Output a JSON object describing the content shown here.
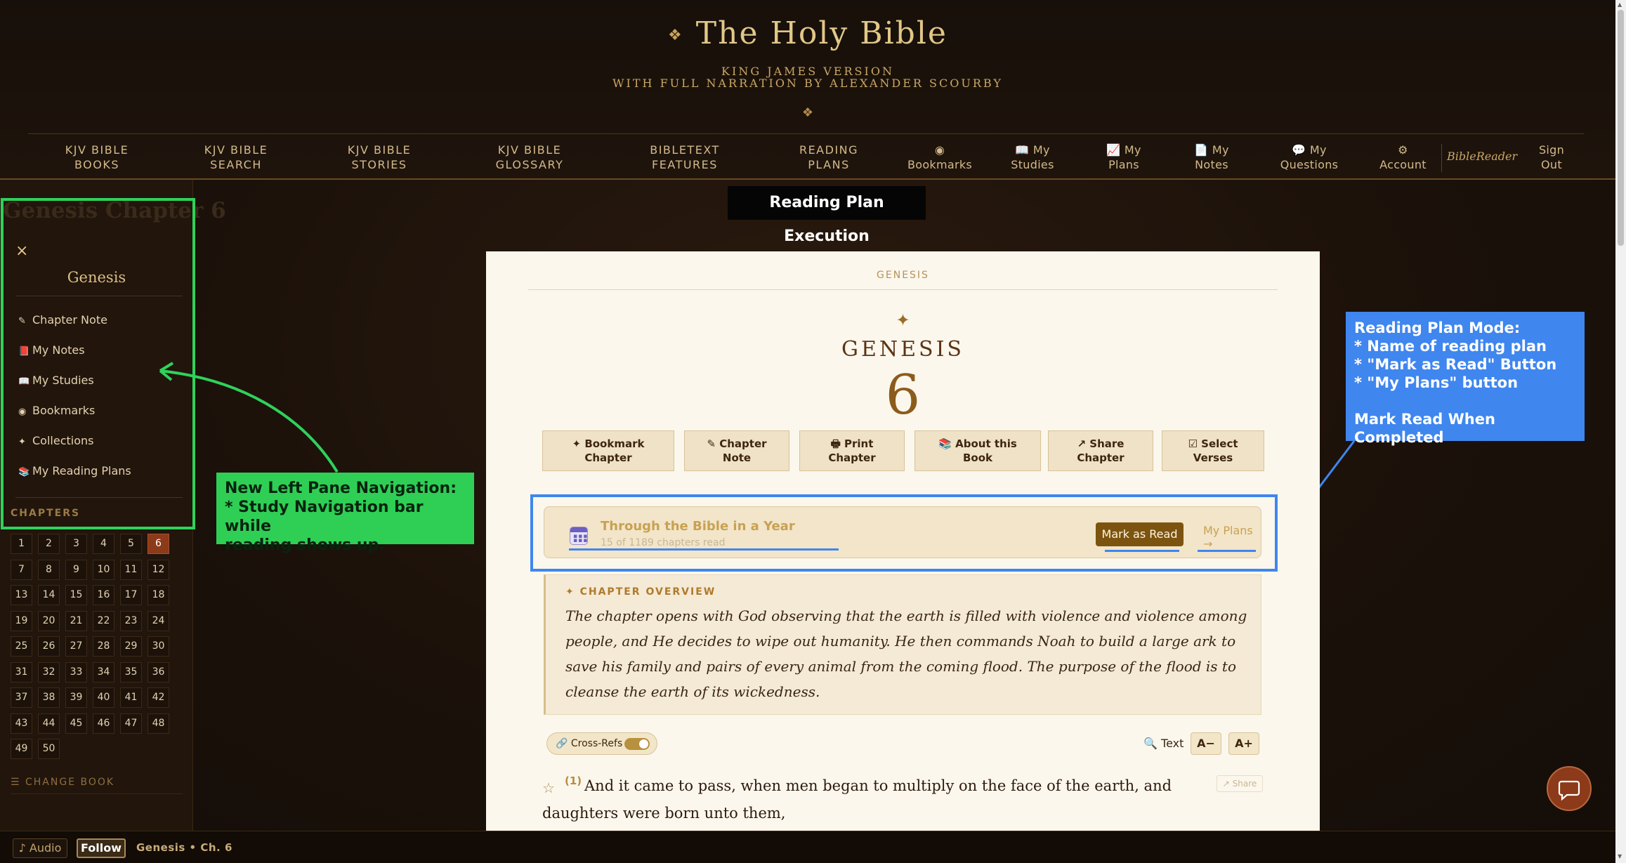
{
  "header": {
    "title": "The Holy Bible",
    "title_ornament": "❖",
    "subtitle_line1": "KING JAMES VERSION",
    "subtitle_line2": "WITH FULL NARRATION BY ALEXANDER SCOURBY",
    "ornament": "❖"
  },
  "nav": {
    "items": [
      {
        "line1": "KJV BIBLE",
        "line2": "BOOKS"
      },
      {
        "line1": "KJV BIBLE",
        "line2": "SEARCH"
      },
      {
        "line1": "KJV BIBLE",
        "line2": "STORIES"
      },
      {
        "line1": "KJV BIBLE",
        "line2": "GLOSSARY"
      },
      {
        "line1": "BIBLETEXT",
        "line2": "FEATURES"
      },
      {
        "line1": "READING",
        "line2": "PLANS"
      },
      {
        "line1": "◉",
        "line2": "Bookmarks"
      },
      {
        "line1": "📖 My",
        "line2": "Studies"
      },
      {
        "line1": "📈 My",
        "line2": "Plans"
      },
      {
        "line1": "📄 My",
        "line2": "Notes"
      },
      {
        "line1": "💬 My",
        "line2": "Questions"
      },
      {
        "line1": "⚙",
        "line2": "Account"
      },
      {
        "line1": "Sign",
        "line2": "Out"
      }
    ],
    "biblereader": "BibleReader"
  },
  "annotation_top": "Reading Plan Execution",
  "left_pane": {
    "ghost_title": "Genesis Chapter 6",
    "close": "×",
    "book": "Genesis",
    "links": [
      {
        "icon": "✎",
        "label": "Chapter Note"
      },
      {
        "icon": "📕",
        "label": "My Notes"
      },
      {
        "icon": "📖",
        "label": "My Studies"
      },
      {
        "icon": "◉",
        "label": "Bookmarks"
      },
      {
        "icon": "✦",
        "label": "Collections"
      },
      {
        "icon": "📚",
        "label": "My Reading Plans"
      }
    ],
    "chapters_label": "CHAPTERS",
    "chapters": [
      "1",
      "2",
      "3",
      "4",
      "5",
      "6",
      "7",
      "8",
      "9",
      "10",
      "11",
      "12",
      "13",
      "14",
      "15",
      "16",
      "17",
      "18",
      "19",
      "20",
      "21",
      "22",
      "23",
      "24",
      "25",
      "26",
      "27",
      "28",
      "29",
      "30",
      "31",
      "32",
      "33",
      "34",
      "35",
      "36",
      "37",
      "38",
      "39",
      "40",
      "41",
      "42",
      "43",
      "44",
      "45",
      "46",
      "47",
      "48",
      "49",
      "50"
    ],
    "active_chapter": "6",
    "change_book": "☰ CHANGE BOOK"
  },
  "green_note": {
    "line1": "New Left Pane Navigation:",
    "line2": "* Study Navigation bar while",
    "line3": "reading shows up."
  },
  "reader": {
    "top_book": "GENESIS",
    "star": "✦",
    "book": "GENESIS",
    "chapter": "6",
    "actions": [
      {
        "line1": "✦ Bookmark",
        "line2": "Chapter"
      },
      {
        "line1": "✎ Chapter",
        "line2": "Note"
      },
      {
        "line1": "🖶 Print",
        "line2": "Chapter"
      },
      {
        "line1": "📚 About this",
        "line2": "Book"
      },
      {
        "line1": "↗ Share",
        "line2": "Chapter"
      },
      {
        "line1": "☑ Select",
        "line2": "Verses"
      }
    ],
    "plan": {
      "name": "Through the Bible in a Year",
      "progress": "15 of 1189 chapters read",
      "mark_read": "Mark as Read",
      "my_plans": "My Plans →"
    },
    "overview": {
      "label": "✦ CHAPTER OVERVIEW",
      "text": "The chapter opens with God observing that the earth is filled with violence and violence among people, and He decides to wipe out humanity. He then commands Noah to build a large ark to save his family and pairs of every animal from the coming flood. The purpose of the flood is to cleanse the earth of its wickedness."
    },
    "crossrefs": "🔗 Cross-Refs",
    "text_search": "🔍 Text",
    "font_minus": "A−",
    "font_plus": "A+",
    "verse": {
      "star": "☆",
      "num": "(1)",
      "text": "And it came to pass, when men began to multiply on the face of the earth, and daughters were born unto them,",
      "share": "↗ Share"
    }
  },
  "blue_note": {
    "line1": "Reading Plan Mode:",
    "line2": "* Name of reading plan",
    "line3": "* \"Mark as Read\" Button",
    "line4": "* \"My Plans\" button",
    "line5": "Mark Read When Completed"
  },
  "bottom_bar": {
    "audio": "♪ Audio",
    "follow": "Follow",
    "now_playing": "Genesis • Ch. 6"
  },
  "colors": {
    "annotation_green": "#2fd25a",
    "annotation_blue": "#3f86ef",
    "active_chapter": "#8b3a1a",
    "mark_read": "#7c5410"
  }
}
